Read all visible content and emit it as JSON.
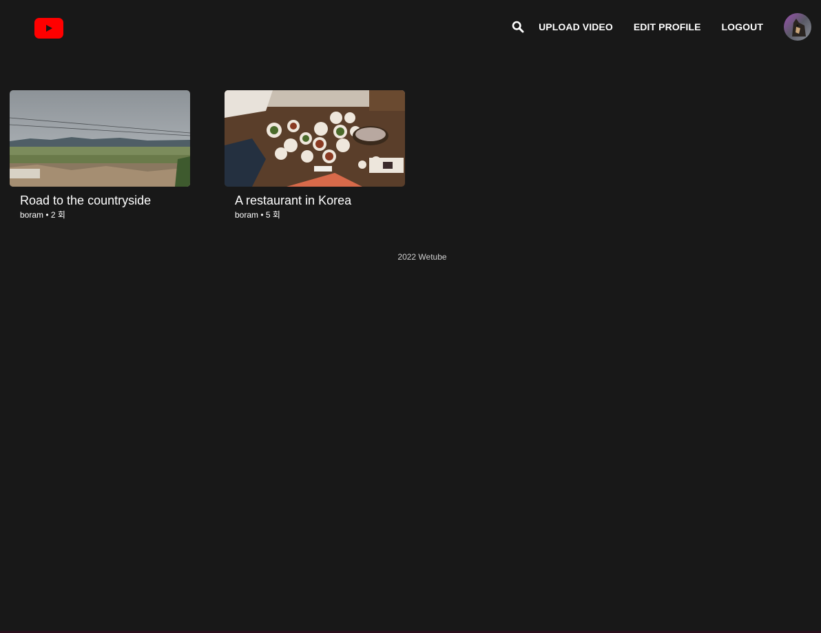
{
  "header": {
    "logo_icon": "youtube-play-icon",
    "search_icon": "search-icon",
    "nav": {
      "upload_label": "UPLOAD VIDEO",
      "edit_profile_label": "EDIT PROFILE",
      "logout_label": "LOGOUT"
    },
    "avatar_icon": "user-avatar"
  },
  "colors": {
    "background": "#181818",
    "logo_red": "#ff0000",
    "text": "#ffffff"
  },
  "videos": [
    {
      "title": "Road to the countryside",
      "owner": "boram",
      "separator": "•",
      "views": "2 회"
    },
    {
      "title": "A restaurant in Korea",
      "owner": "boram",
      "separator": "•",
      "views": "5 회"
    }
  ],
  "footer": {
    "text": "2022 Wetube"
  }
}
